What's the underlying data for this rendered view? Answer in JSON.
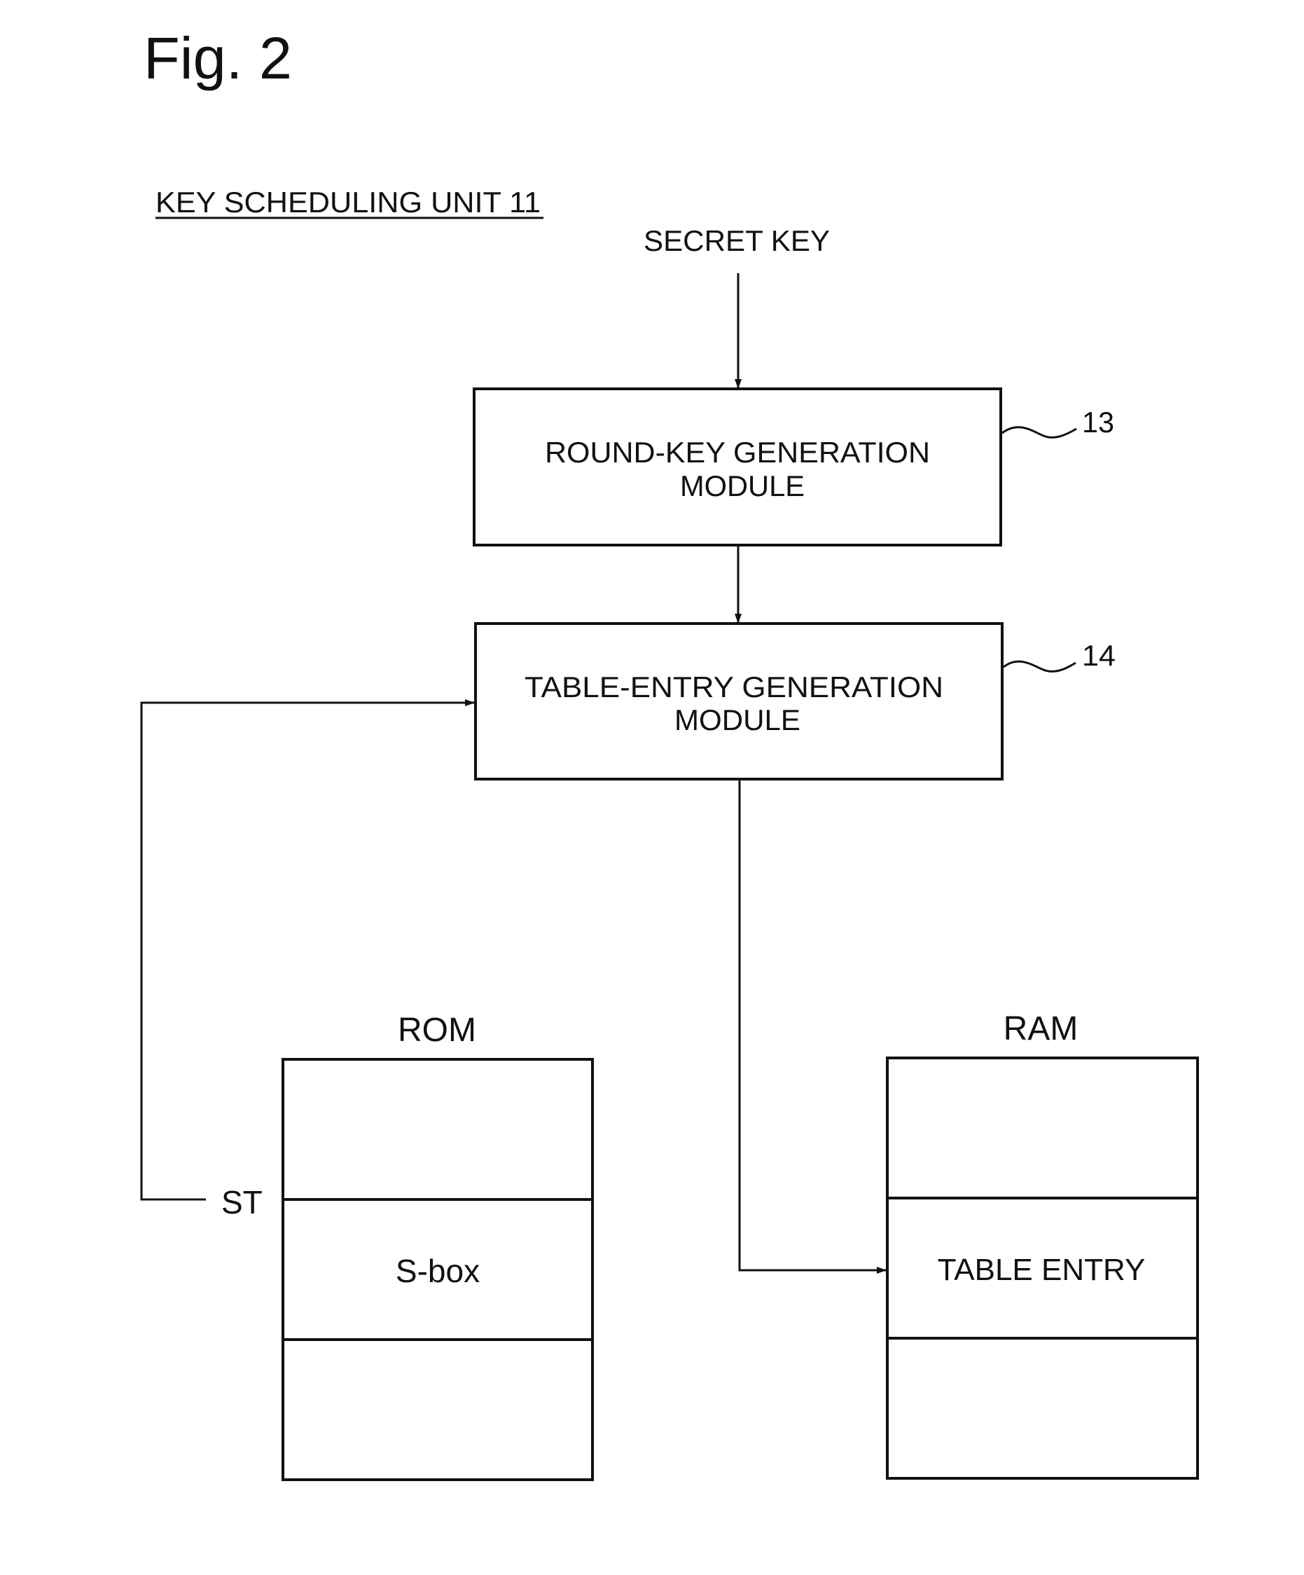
{
  "figure": {
    "title": "Fig. 2",
    "unit_label": "KEY SCHEDULING UNIT 11"
  },
  "inputs": {
    "secret_key": "SECRET KEY"
  },
  "modules": [
    {
      "id": "round_key",
      "line1": "ROUND-KEY GENERATION",
      "line2": "MODULE",
      "ref": "13"
    },
    {
      "id": "table_entry",
      "line1": "TABLE-ENTRY GENERATION",
      "line2": "MODULE",
      "ref": "14"
    }
  ],
  "memories": {
    "rom": {
      "label": "ROM",
      "cells": [
        "",
        "S-box",
        ""
      ],
      "pointer_label": "ST"
    },
    "ram": {
      "label": "RAM",
      "cells": [
        "",
        "TABLE ENTRY",
        ""
      ]
    }
  },
  "colors": {
    "ink": "#111111",
    "background": "#ffffff"
  }
}
